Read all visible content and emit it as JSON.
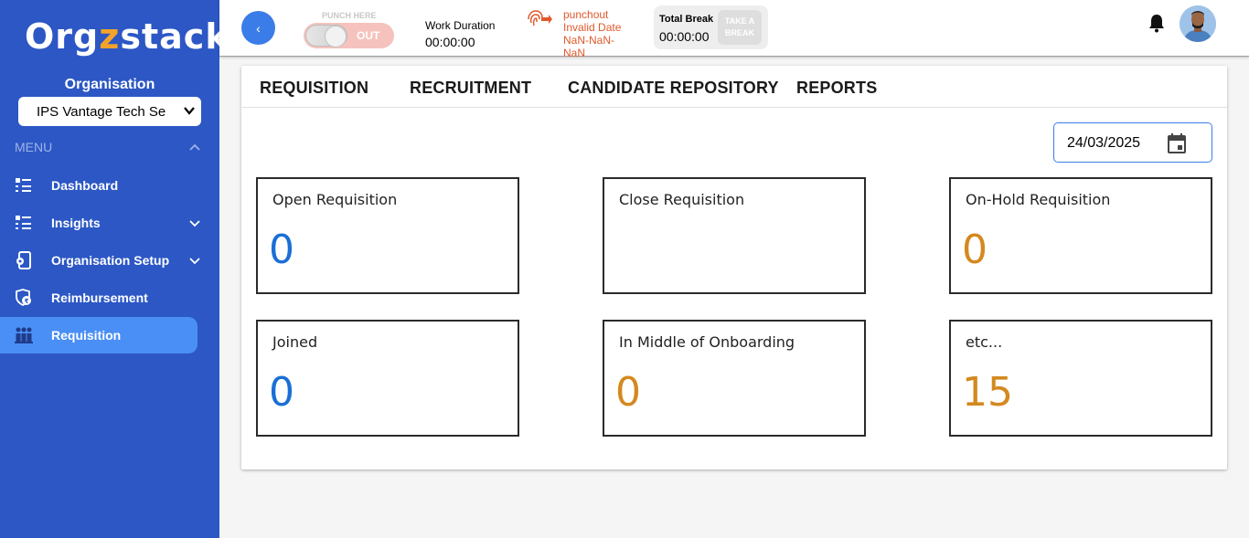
{
  "brand": {
    "logo_pre": "Org",
    "logo_accent": "z",
    "logo_post": "stack",
    "accent_color": "#f3a32a"
  },
  "sidebar": {
    "organisation_label": "Organisation",
    "organisation_selected": "IPS Vantage Tech Se",
    "menu_label": "MENU",
    "items": [
      {
        "label": "Dashboard",
        "icon": "list-icon",
        "has_submenu": false
      },
      {
        "label": "Insights",
        "icon": "list-icon",
        "has_submenu": true
      },
      {
        "label": "Organisation Setup",
        "icon": "phone-gear-icon",
        "has_submenu": true
      },
      {
        "label": "Reimbursement",
        "icon": "shield-rupee-icon",
        "has_submenu": false
      },
      {
        "label": "Requisition",
        "icon": "people-icon",
        "has_submenu": false,
        "active": true
      }
    ]
  },
  "header": {
    "back_label": "‹",
    "punch_here": "PUNCH HERE",
    "punch_state": "OUT",
    "work_duration_label": "Work Duration",
    "work_duration_value": "00:00:00",
    "punch_info_1": "punchout",
    "punch_info_2": "Invalid Date",
    "punch_info_3": "NaN-NaN-",
    "punch_info_4": "NaN",
    "total_break_label": "Total Break",
    "total_break_value": "00:00:00",
    "take_break_1": "TAKE A",
    "take_break_2": "BREAK"
  },
  "tabs": [
    "REQUISITION",
    "RECRUITMENT",
    "CANDIDATE REPOSITORY",
    "REPORTS"
  ],
  "date_value": "24/03/2025",
  "stats": [
    {
      "title": "Open Requisition",
      "value": "0",
      "color": "#1a6fd6"
    },
    {
      "title": "Close Requisition",
      "value": "",
      "color": "#1a6fd6"
    },
    {
      "title": "On-Hold Requisition",
      "value": "0",
      "color": "#d4891f"
    },
    {
      "title": "Joined",
      "value": "0",
      "color": "#1a6fd6"
    },
    {
      "title": "In Middle of Onboarding",
      "value": "0",
      "color": "#d4891f"
    },
    {
      "title": "etc...",
      "value": "15",
      "color": "#d4891f"
    }
  ]
}
